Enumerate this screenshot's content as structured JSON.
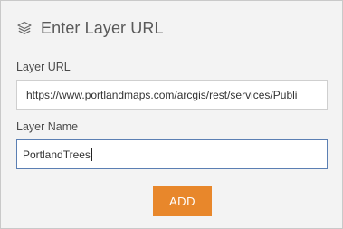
{
  "header": {
    "icon": "layers-icon",
    "title": "Enter Layer URL"
  },
  "form": {
    "url_label": "Layer URL",
    "url_value": "https://www.portlandmaps.com/arcgis/rest/services/Publi",
    "name_label": "Layer Name",
    "name_value": "PortlandTrees"
  },
  "actions": {
    "add_label": "ADD"
  },
  "colors": {
    "accent": "#e8872b",
    "panel_bg": "#f3f3f3",
    "focus_border": "#5b7fb3"
  }
}
